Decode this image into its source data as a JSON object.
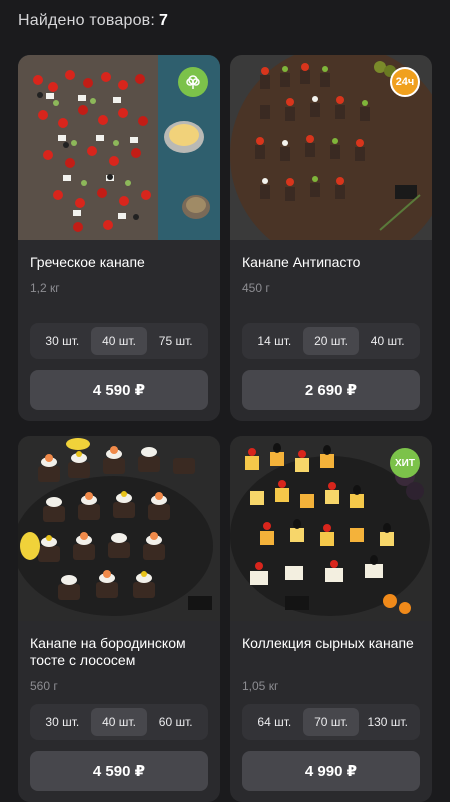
{
  "header": {
    "label": "Найдено товаров:",
    "count": "7"
  },
  "products": [
    {
      "title": "Греческое канапе",
      "weight": "1,2 кг",
      "sizes": [
        "30 шт.",
        "40 шт.",
        "75 шт."
      ],
      "selected": 1,
      "price": "4 590 ₽",
      "badge": "veg-icon"
    },
    {
      "title": "Канапе Антипасто",
      "weight": "450 г",
      "sizes": [
        "14 шт.",
        "20 шт.",
        "40 шт."
      ],
      "selected": 1,
      "price": "2 690 ₽",
      "badge_text": "24ч"
    },
    {
      "title": "Канапе на бородинском тосте с лососем",
      "weight": "560 г",
      "sizes": [
        "30 шт.",
        "40 шт.",
        "60 шт."
      ],
      "selected": 1,
      "price": "4 590 ₽"
    },
    {
      "title": "Коллекция сырных канапе",
      "weight": "1,05 кг",
      "sizes": [
        "64 шт.",
        "70 шт.",
        "130 шт."
      ],
      "selected": 1,
      "price": "4 990 ₽",
      "badge_text": "ХИТ"
    }
  ],
  "colors": {
    "background": "#1b1b1d",
    "card": "#2a2a2d",
    "button": "#47474c",
    "badge_green": "#7cc24a",
    "badge_orange": "#f0a01e"
  }
}
